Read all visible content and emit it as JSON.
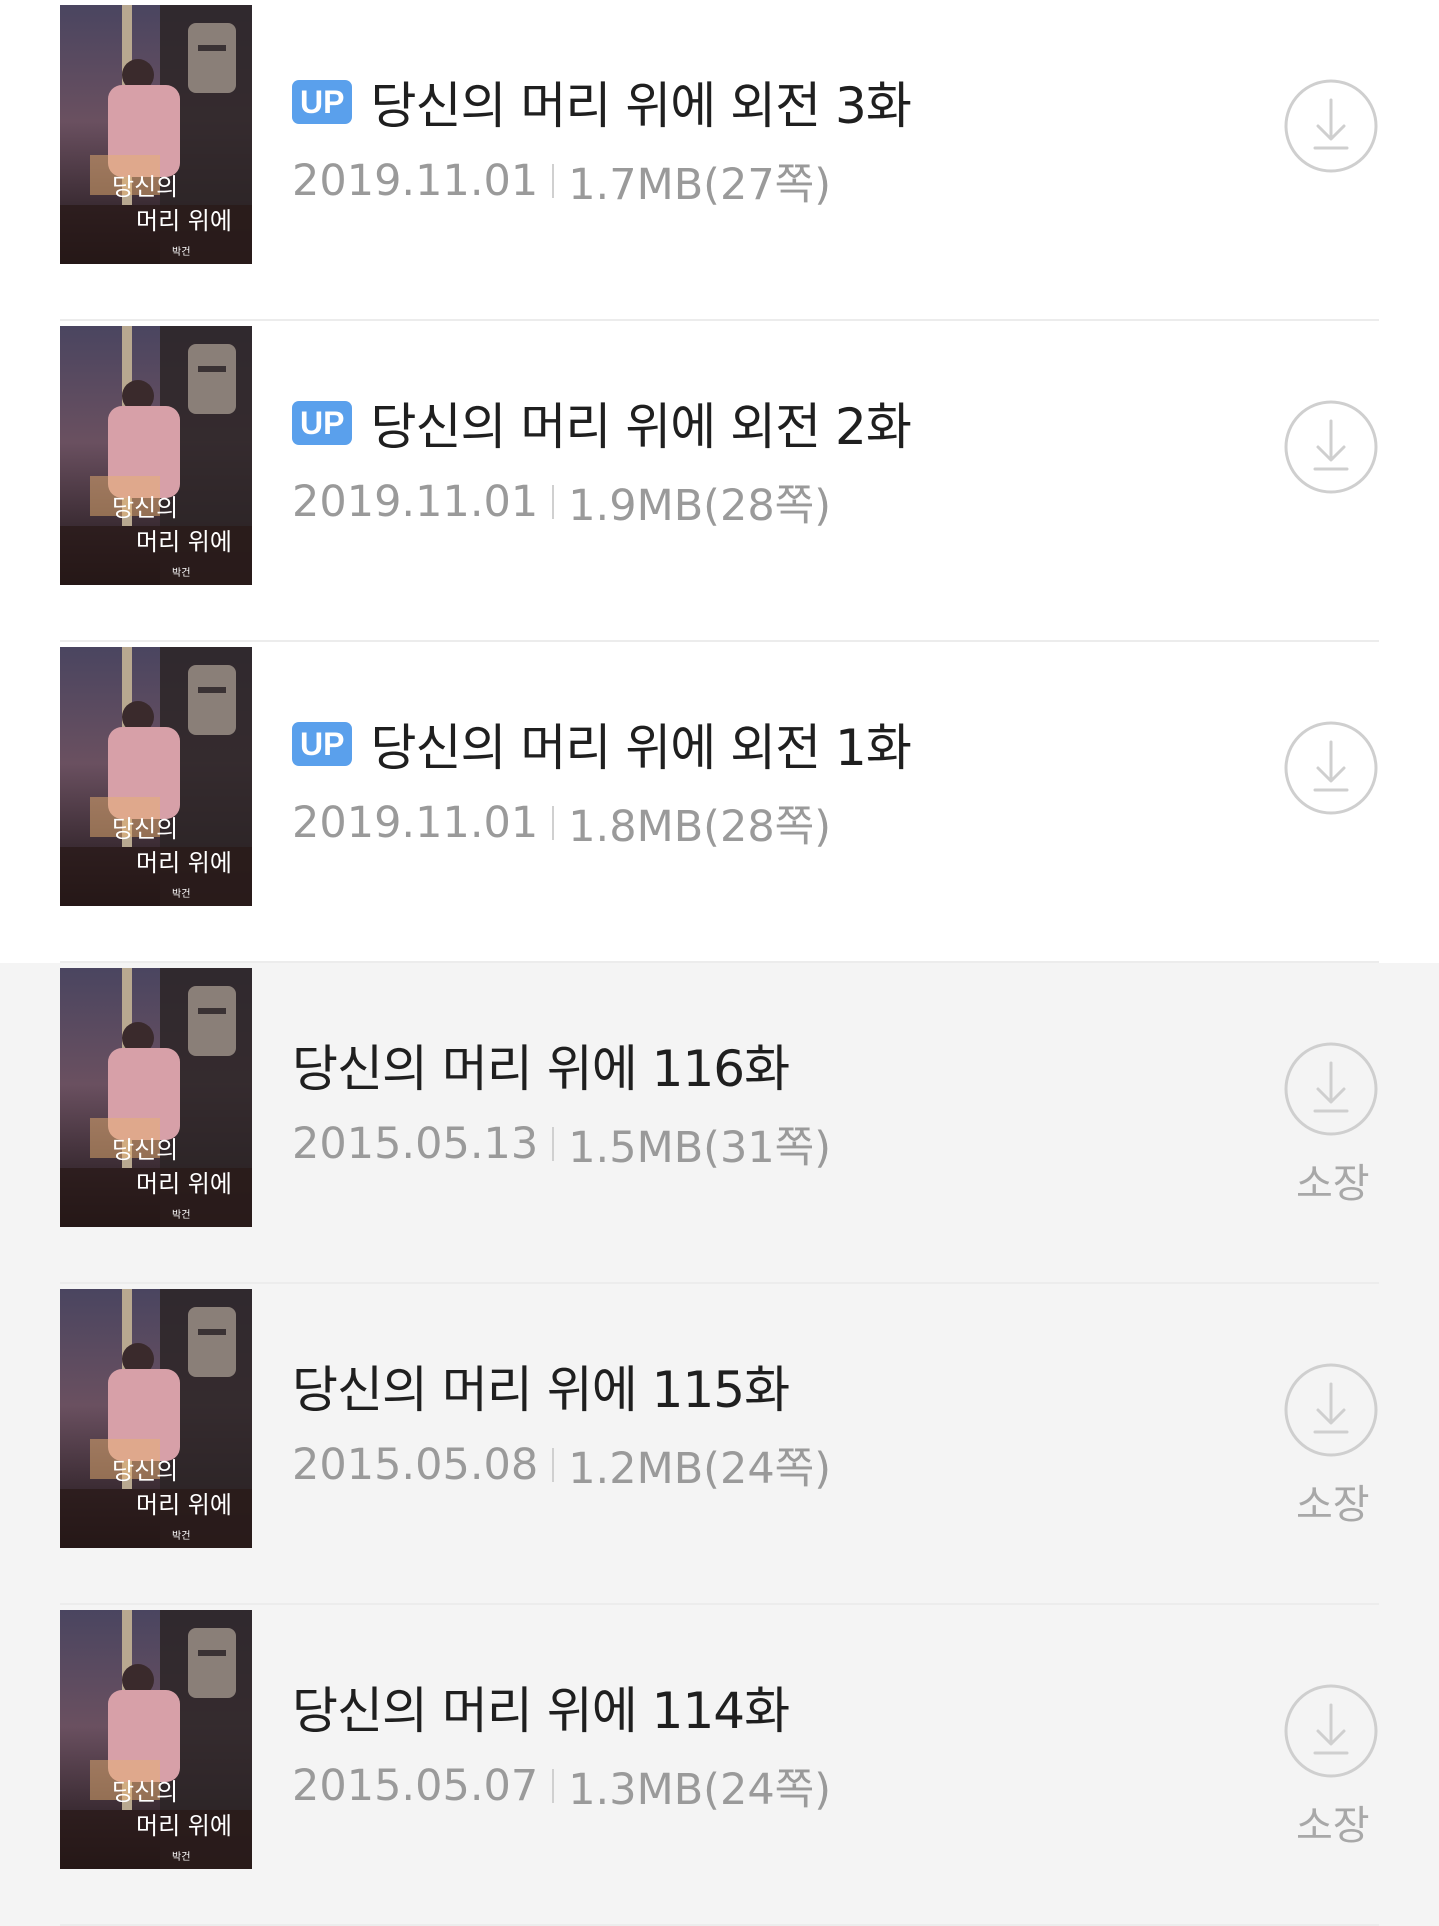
{
  "episodes": [
    {
      "badge": "UP",
      "title": "당신의 머리 위에 외전 3화",
      "date": "2019.11.01",
      "size": "1.7MB(27쪽)",
      "status": "",
      "highlight": false
    },
    {
      "badge": "UP",
      "title": "당신의 머리 위에 외전 2화",
      "date": "2019.11.01",
      "size": "1.9MB(28쪽)",
      "status": "",
      "highlight": false
    },
    {
      "badge": "UP",
      "title": "당신의 머리 위에 외전 1화",
      "date": "2019.11.01",
      "size": "1.8MB(28쪽)",
      "status": "",
      "highlight": false
    },
    {
      "badge": "",
      "title": "당신의 머리 위에 116화",
      "date": "2015.05.13",
      "size": "1.5MB(31쪽)",
      "status": "소장",
      "highlight": true
    },
    {
      "badge": "",
      "title": "당신의 머리 위에 115화",
      "date": "2015.05.08",
      "size": "1.2MB(24쪽)",
      "status": "소장",
      "highlight": true
    },
    {
      "badge": "",
      "title": "당신의 머리 위에 114화",
      "date": "2015.05.07",
      "size": "1.3MB(24쪽)",
      "status": "소장",
      "highlight": true
    }
  ],
  "cover": {
    "title_line1": "당신의",
    "title_line2": "머리 위에",
    "author": "박건"
  },
  "colors": {
    "badge": "#5aa0ec",
    "title": "#1f1f1f",
    "meta": "#9a9a9a",
    "icon": "#cfcfcf",
    "owned_background": "#f4f4f4"
  },
  "icons": {
    "download": "download-arrow-circle-icon"
  }
}
